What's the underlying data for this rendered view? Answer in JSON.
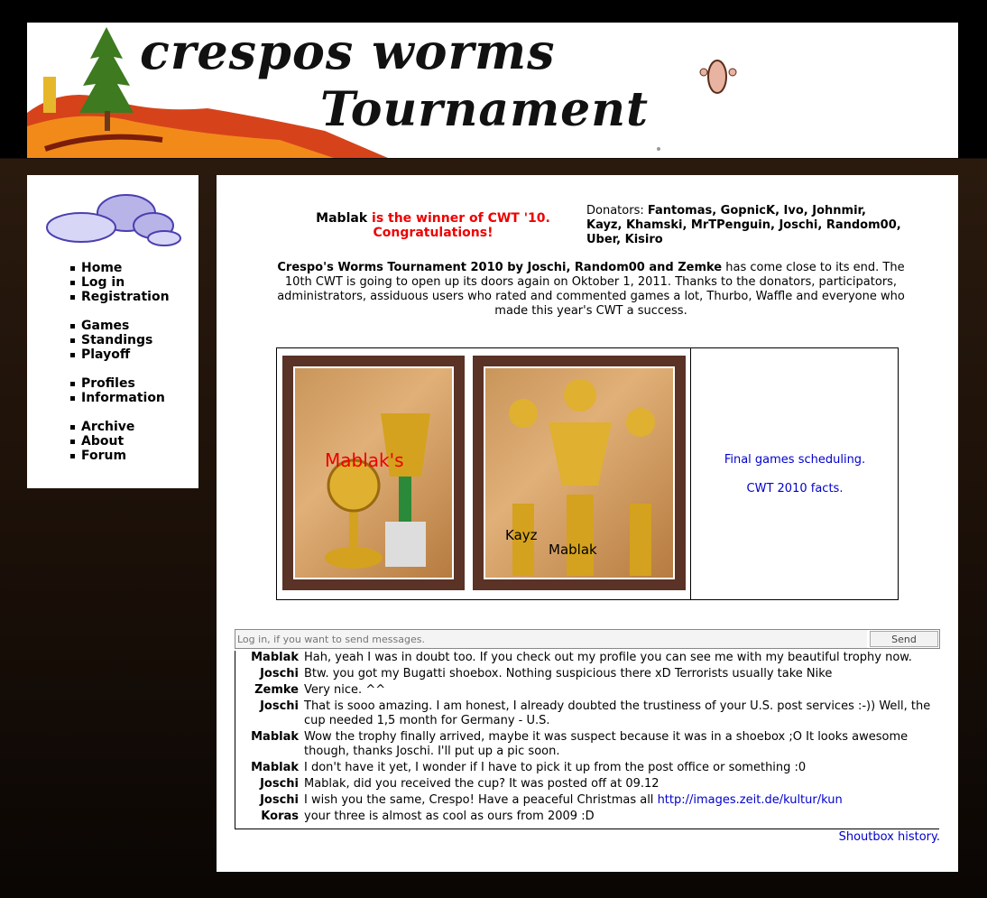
{
  "banner": {
    "title_line1": "crespos worms",
    "title_line2": "Tournament"
  },
  "nav": {
    "groups": [
      [
        "Home",
        "Log in",
        "Registration"
      ],
      [
        "Games",
        "Standings",
        "Playoff"
      ],
      [
        "Profiles",
        "Information"
      ],
      [
        "Archive",
        "About",
        "Forum"
      ]
    ]
  },
  "winner": {
    "name": "Mablak",
    "text": "is the winner of CWT '10.",
    "congrats": "Congratulations!"
  },
  "donators": {
    "label": "Donators:",
    "names": "Fantomas, GopnicK, Ivo, Johnmir, Kayz, Khamski, MrTPenguin, Joschi, Random00, Uber, Kisiro"
  },
  "intro": {
    "bold": "Crespo's Worms Tournament 2010 by Joschi, Random00 and Zemke",
    "rest": " has come close to its end. The 10th CWT is going to open up its doors again on Oktober 1, 2011. Thanks to the donators, participators, administrators, assiduous users who rated and commented games a lot, Thurbo, Waffle and everyone who made this year's CWT a success."
  },
  "photos": {
    "photo1_label": "Mablak's",
    "photo2_label_left": "Kayz",
    "photo2_label_center": "Mablak"
  },
  "links": {
    "final_games": "Final games scheduling.",
    "facts": "CWT 2010 facts."
  },
  "shoutbox": {
    "placeholder": "Log in, if you want to send messages.",
    "send_label": "Send",
    "messages": [
      {
        "user": "Mablak",
        "text": "Hah, yeah I was in doubt too. If you check out my profile you can see me with my beautiful trophy now."
      },
      {
        "user": "Joschi",
        "text": "Btw. you got my Bugatti shoebox. Nothing suspicious there xD Terrorists usually take Nike"
      },
      {
        "user": "Zemke",
        "text": "Very nice. ^^"
      },
      {
        "user": "Joschi",
        "text": "That is sooo amazing. I am honest, I already doubted the trustiness of your U.S. post services :-)) Well, the cup needed 1,5 month for Germany - U.S."
      },
      {
        "user": "Mablak",
        "text": "Wow the trophy finally arrived, maybe it was suspect because it was in a shoebox ;O It looks awesome though, thanks Joschi. I'll put up a pic soon."
      },
      {
        "user": "Mablak",
        "text": "I don't have it yet, I wonder if I have to pick it up from the post office or something :0"
      },
      {
        "user": "Joschi",
        "text": "Mablak, did you received the cup? It was posted off at 09.12"
      },
      {
        "user": "Joschi",
        "text": "I wish you the same, Crespo! Have a peaceful Christmas all ",
        "link": "http://images.zeit.de/kultur/kun"
      },
      {
        "user": "Koras",
        "text": "your three is almost as cool as ours from 2009 :D"
      }
    ],
    "history_label": "Shoutbox history."
  }
}
